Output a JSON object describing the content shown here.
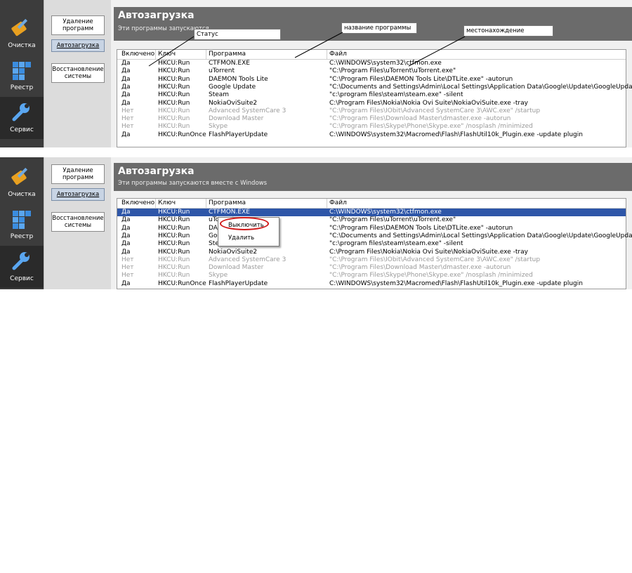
{
  "sidebar": {
    "items": [
      {
        "label": "Очистка",
        "icon": "broom-icon"
      },
      {
        "label": "Реестр",
        "icon": "registry-cubes-icon"
      },
      {
        "label": "Сервис",
        "icon": "wrench-icon"
      }
    ]
  },
  "subnav": {
    "uninstall": "Удаление программ",
    "startup": "Автозагрузка",
    "restore": "Восстановление системы"
  },
  "header": {
    "title": "Автозагрузка",
    "subtitle": "Эти программы запускаются вместе с Windows",
    "subtitle_partial": "Эти программы запускаются"
  },
  "table": {
    "columns": [
      "Включено",
      "Ключ",
      "Программа",
      "Файл"
    ],
    "rows": [
      {
        "enabled": "Да",
        "key": "HKCU:Run",
        "program": "CTFMON.EXE",
        "file": "C:\\WINDOWS\\system32\\ctfmon.exe",
        "disabled": false
      },
      {
        "enabled": "Да",
        "key": "HKCU:Run",
        "program": "uTorrent",
        "file": "\"C:\\Program Files\\uTorrent\\uTorrent.exe\"",
        "disabled": false
      },
      {
        "enabled": "Да",
        "key": "HKCU:Run",
        "program": "DAEMON Tools Lite",
        "file": "\"C:\\Program Files\\DAEMON Tools Lite\\DTLite.exe\" -autorun",
        "disabled": false
      },
      {
        "enabled": "Да",
        "key": "HKCU:Run",
        "program": "Google Update",
        "file": "\"C:\\Documents and Settings\\Admin\\Local Settings\\Application Data\\Google\\Update\\GoogleUpdate.exe\" /c",
        "disabled": false
      },
      {
        "enabled": "Да",
        "key": "HKCU:Run",
        "program": "Steam",
        "file": "\"c:\\program files\\steam\\steam.exe\" -silent",
        "disabled": false
      },
      {
        "enabled": "Да",
        "key": "HKCU:Run",
        "program": "NokiaOviSuite2",
        "file": "C:\\Program Files\\Nokia\\Nokia Ovi Suite\\NokiaOviSuite.exe -tray",
        "disabled": false
      },
      {
        "enabled": "Нет",
        "key": "HKCU:Run",
        "program": "Advanced SystemCare 3",
        "file": "\"C:\\Program Files\\IObit\\Advanced SystemCare 3\\AWC.exe\" /startup",
        "disabled": true
      },
      {
        "enabled": "Нет",
        "key": "HKCU:Run",
        "program": "Download Master",
        "file": "\"C:\\Program Files\\Download Master\\dmaster.exe -autorun",
        "disabled": true
      },
      {
        "enabled": "Нет",
        "key": "HKCU:Run",
        "program": "Skype",
        "file": "\"C:\\Program Files\\Skype\\Phone\\Skype.exe\" /nosplash /minimized",
        "disabled": true
      },
      {
        "enabled": "Да",
        "key": "HKCU:RunOnce",
        "program": "FlashPlayerUpdate",
        "file": "C:\\WINDOWS\\system32\\Macromed\\Flash\\FlashUtil10k_Plugin.exe -update plugin",
        "disabled": false
      }
    ]
  },
  "annotations": {
    "status": "Статус",
    "program_name": "название программы",
    "location": "местонахождение"
  },
  "context_menu": {
    "disable": "Выключить",
    "delete": "Удалить"
  },
  "colors": {
    "sidebar": "#3c3c3c",
    "header": "#6b6b6b",
    "selection": "#2e56a8",
    "highlight_ring": "#d01818"
  }
}
